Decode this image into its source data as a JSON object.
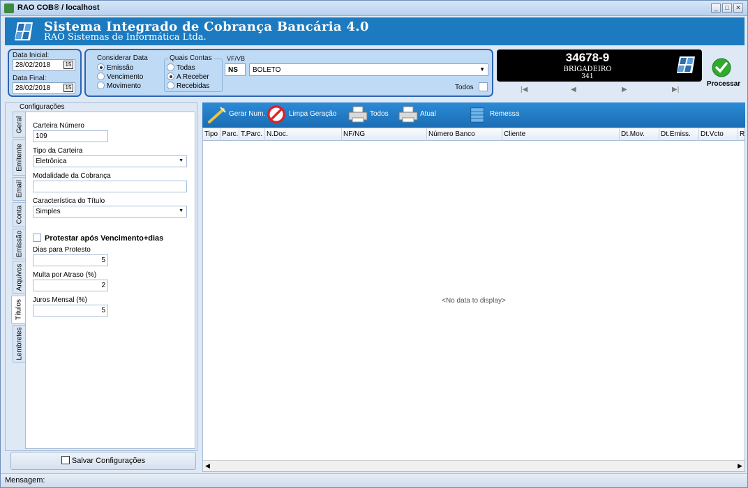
{
  "window": {
    "title": "RAO COB® / localhost"
  },
  "banner": {
    "title": "Sistema Integrado de Cobrança Bancária 4.0",
    "subtitle": "RAO Sistemas de Informática Ltda."
  },
  "dates": {
    "initial_label": "Data Inicial:",
    "initial_value": "28/02/2018",
    "final_label": "Data Final:",
    "final_value": "28/02/2018",
    "calendar_glyph": "15"
  },
  "considerar": {
    "label": "Considerar Data",
    "options": [
      "Emissão",
      "Vencimento",
      "Movimento"
    ],
    "selected": "Emissão"
  },
  "quais": {
    "label": "Quais Contas",
    "options": [
      "Todas",
      "A Receber",
      "Recebidas"
    ],
    "selected": "A Receber"
  },
  "vfvb": {
    "label": "VF/VB",
    "value": "NS"
  },
  "carteira_combo": {
    "value": "BOLETO"
  },
  "todos_label": "Todos",
  "bank": {
    "number": "34678-9",
    "name": "BRIGADEIRO",
    "code": "341"
  },
  "nav": [
    "|◀",
    "◀",
    "▶",
    "▶|"
  ],
  "processar_label": "Processar",
  "config": {
    "group_label": "Configurações",
    "tabs": [
      "Geral",
      "Emitente",
      "Email",
      "Conta",
      "Emissão",
      "Arquivos",
      "Títulos",
      "Lembretes"
    ],
    "active_tab": "Títulos",
    "carteira_numero_label": "Carteira Número",
    "carteira_numero": "109",
    "tipo_carteira_label": "Tipo da Carteira",
    "tipo_carteira": "Eletrônica",
    "modalidade_label": "Modalidade da Cobrança",
    "modalidade": "",
    "caracteristica_label": "Característica do Título",
    "caracteristica": "Simples",
    "protestar_label": "Protestar após Vencimento+dias",
    "dias_protesto_label": "Dias para Protesto",
    "dias_protesto": "5",
    "multa_label": "Multa por Atraso (%)",
    "multa": "2",
    "juros_label": "Juros Mensal (%)",
    "juros": "5",
    "save_label": "Salvar Configurações"
  },
  "toolbar": {
    "gerar": "Gerar Num.",
    "limpa": "Limpa Geração",
    "todos": "Todos",
    "atual": "Atual",
    "remessa": "Remessa"
  },
  "grid": {
    "columns": [
      "Tipo",
      "Parc.",
      "T.Parc.",
      "N.Doc.",
      "NF/NG",
      "Número Banco",
      "Cliente",
      "Dt.Mov.",
      "Dt.Emiss.",
      "Dt.Vcto",
      "R"
    ],
    "empty_text": "<No data to display>"
  },
  "status": {
    "label": "Mensagem:"
  },
  "colors": {
    "banner": "#1c7bc0",
    "toolbar": "#1f78c4",
    "panel_border": "#2c63b5",
    "panel_fill": "#bfdaf5",
    "processar_green": "#2faa2f"
  }
}
